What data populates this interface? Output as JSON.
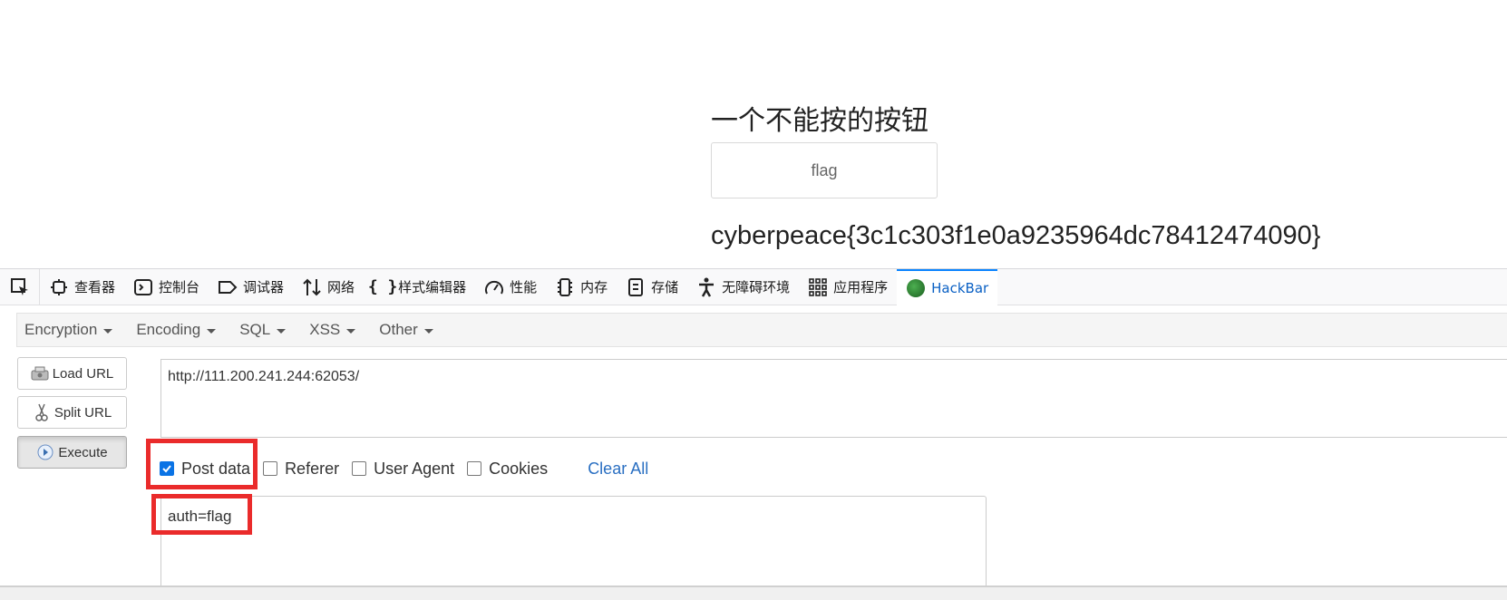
{
  "page": {
    "heading": "一个不能按的按钮",
    "button_label": "flag",
    "result_text": "cyberpeace{3c1c303f1e0a9235964dc78412474090}"
  },
  "devtools": {
    "tabs": [
      {
        "label": "查看器",
        "icon": "inspector-icon"
      },
      {
        "label": "控制台",
        "icon": "console-icon"
      },
      {
        "label": "调试器",
        "icon": "debugger-icon"
      },
      {
        "label": "网络",
        "icon": "network-icon"
      },
      {
        "label": "样式编辑器",
        "icon": "style-editor-icon"
      },
      {
        "label": "性能",
        "icon": "performance-icon"
      },
      {
        "label": "内存",
        "icon": "memory-icon"
      },
      {
        "label": "存储",
        "icon": "storage-icon"
      },
      {
        "label": "无障碍环境",
        "icon": "accessibility-icon"
      },
      {
        "label": "应用程序",
        "icon": "application-icon"
      },
      {
        "label": "HackBar",
        "icon": "hackbar-logo-icon",
        "active": true
      }
    ],
    "active_color": "#0a60c4"
  },
  "hackbar": {
    "menu": [
      "Encryption",
      "Encoding",
      "SQL",
      "XSS",
      "Other"
    ],
    "buttons": {
      "load_url": "Load URL",
      "split_url": "Split URL",
      "execute": "Execute"
    },
    "url_value": "http://111.200.241.244:62053/",
    "options": {
      "post_data": {
        "label": "Post data",
        "checked": true
      },
      "referer": {
        "label": "Referer",
        "checked": false
      },
      "user_agent": {
        "label": "User Agent",
        "checked": false
      },
      "cookies": {
        "label": "Cookies",
        "checked": false
      }
    },
    "clear_all": "Clear All",
    "post_value": "auth=flag",
    "highlight_color": "#ea2b2b"
  }
}
